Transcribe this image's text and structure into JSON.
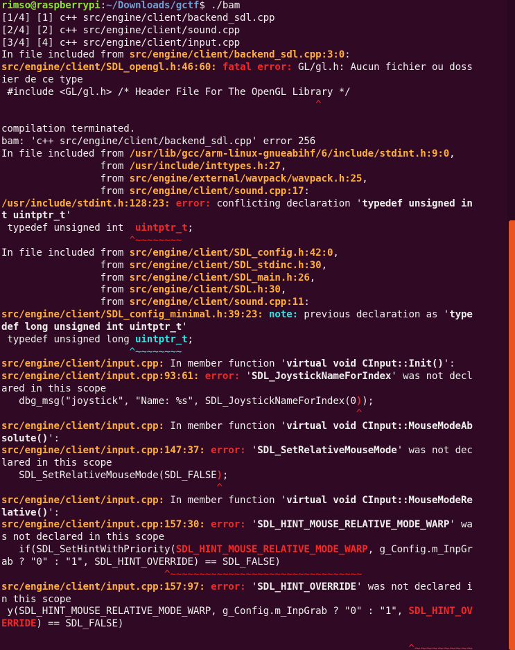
{
  "terminal": {
    "lines": [
      [
        [
          "prompt",
          "rimso@raspberrypi"
        ],
        [
          "plain",
          ":"
        ],
        [
          "path",
          "~/Downloads/gctf"
        ],
        [
          "plain",
          "$ ./bam"
        ]
      ],
      [
        [
          "plain",
          "[1/4] [1] c++ src/engine/client/backend_sdl.cpp"
        ]
      ],
      [
        [
          "plain",
          "[2/4] [2] c++ src/engine/client/sound.cpp"
        ]
      ],
      [
        [
          "plain",
          "[3/4] [4] c++ src/engine/client/input.cpp"
        ]
      ],
      [
        [
          "plain",
          "In file included from "
        ],
        [
          "file",
          "src/engine/client/backend_sdl.cpp:3:0"
        ],
        [
          "plain",
          ":"
        ]
      ],
      [
        [
          "file",
          "src/engine/client/SDL_opengl.h:46:60:"
        ],
        [
          "plain",
          " "
        ],
        [
          "err",
          "fatal error:"
        ],
        [
          "plain",
          " GL/gl.h: Aucun fichier ou doss"
        ]
      ],
      [
        [
          "plain",
          "ier de ce type"
        ]
      ],
      [
        [
          "plain",
          " #include <GL/gl.h> /* Header File For The OpenGL Library */"
        ]
      ],
      [
        [
          "plain",
          "                                                      "
        ],
        [
          "red",
          "^"
        ]
      ],
      [
        [
          "plain",
          ""
        ]
      ],
      [
        [
          "plain",
          "compilation terminated."
        ]
      ],
      [
        [
          "plain",
          "bam: 'c++ src/engine/client/backend_sdl.cpp' error 256"
        ]
      ],
      [
        [
          "plain",
          "In file included from "
        ],
        [
          "file",
          "/usr/lib/gcc/arm-linux-gnueabihf/6/include/stdint.h:9:0"
        ],
        [
          "plain",
          ","
        ]
      ],
      [
        [
          "plain",
          "                 from "
        ],
        [
          "file",
          "/usr/include/inttypes.h:27"
        ],
        [
          "plain",
          ","
        ]
      ],
      [
        [
          "plain",
          "                 from "
        ],
        [
          "file",
          "src/engine/external/wavpack/wavpack.h:25"
        ],
        [
          "plain",
          ","
        ]
      ],
      [
        [
          "plain",
          "                 from "
        ],
        [
          "file",
          "src/engine/client/sound.cpp:17"
        ],
        [
          "plain",
          ":"
        ]
      ],
      [
        [
          "file",
          "/usr/include/stdint.h:128:23:"
        ],
        [
          "plain",
          " "
        ],
        [
          "err",
          "error:"
        ],
        [
          "plain",
          " conflicting declaration '"
        ],
        [
          "bold",
          "typedef unsigned in"
        ]
      ],
      [
        [
          "bold",
          "t uintptr_t"
        ],
        [
          "plain",
          "'"
        ]
      ],
      [
        [
          "plain",
          " typedef unsigned int  "
        ],
        [
          "err",
          "uintptr_t"
        ],
        [
          "plain",
          ";"
        ]
      ],
      [
        [
          "plain",
          "                      "
        ],
        [
          "red",
          "^~~~~~~~~"
        ]
      ],
      [
        [
          "plain",
          "In file included from "
        ],
        [
          "file",
          "src/engine/client/SDL_config.h:42:0"
        ],
        [
          "plain",
          ","
        ]
      ],
      [
        [
          "plain",
          "                 from "
        ],
        [
          "file",
          "src/engine/client/SDL_stdinc.h:30"
        ],
        [
          "plain",
          ","
        ]
      ],
      [
        [
          "plain",
          "                 from "
        ],
        [
          "file",
          "src/engine/client/SDL_main.h:26"
        ],
        [
          "plain",
          ","
        ]
      ],
      [
        [
          "plain",
          "                 from "
        ],
        [
          "file",
          "src/engine/client/SDL.h:30"
        ],
        [
          "plain",
          ","
        ]
      ],
      [
        [
          "plain",
          "                 from "
        ],
        [
          "file",
          "src/engine/client/sound.cpp:11"
        ],
        [
          "plain",
          ":"
        ]
      ],
      [
        [
          "file",
          "src/engine/client/SDL_config_minimal.h:39:23:"
        ],
        [
          "plain",
          " "
        ],
        [
          "note",
          "note:"
        ],
        [
          "plain",
          " previous declaration as '"
        ],
        [
          "bold",
          "type"
        ]
      ],
      [
        [
          "bold",
          "def long unsigned int uintptr_t"
        ],
        [
          "plain",
          "'"
        ]
      ],
      [
        [
          "plain",
          " typedef unsigned long "
        ],
        [
          "note",
          "uintptr_t"
        ],
        [
          "plain",
          ";"
        ]
      ],
      [
        [
          "plain",
          "                      "
        ],
        [
          "cyan",
          "^~~~~~~~~"
        ]
      ],
      [
        [
          "file",
          "src/engine/client/input.cpp:"
        ],
        [
          "plain",
          " In member function '"
        ],
        [
          "bold",
          "virtual void CInput::Init()"
        ],
        [
          "plain",
          "':"
        ]
      ],
      [
        [
          "file",
          "src/engine/client/input.cpp:93:61:"
        ],
        [
          "plain",
          " "
        ],
        [
          "err",
          "error:"
        ],
        [
          "plain",
          " '"
        ],
        [
          "bold",
          "SDL_JoystickNameForIndex"
        ],
        [
          "plain",
          "' was not decl"
        ]
      ],
      [
        [
          "plain",
          "ared in this scope"
        ]
      ],
      [
        [
          "plain",
          "   dbg_msg(\"joystick\", \"Name: %s\", SDL_JoystickNameForIndex(0"
        ],
        [
          "err",
          ")"
        ],
        [
          "plain",
          ");"
        ]
      ],
      [
        [
          "plain",
          "                                                             "
        ],
        [
          "red",
          "^"
        ]
      ],
      [
        [
          "file",
          "src/engine/client/input.cpp:"
        ],
        [
          "plain",
          " In member function '"
        ],
        [
          "bold",
          "virtual void CInput::MouseModeAb"
        ]
      ],
      [
        [
          "bold",
          "solute()"
        ],
        [
          "plain",
          "':"
        ]
      ],
      [
        [
          "file",
          "src/engine/client/input.cpp:147:37:"
        ],
        [
          "plain",
          " "
        ],
        [
          "err",
          "error:"
        ],
        [
          "plain",
          " '"
        ],
        [
          "bold",
          "SDL_SetRelativeMouseMode"
        ],
        [
          "plain",
          "' was not dec"
        ]
      ],
      [
        [
          "plain",
          "lared in this scope"
        ]
      ],
      [
        [
          "plain",
          "   SDL_SetRelativeMouseMode(SDL_FALSE"
        ],
        [
          "err",
          ")"
        ],
        [
          "plain",
          ";"
        ]
      ],
      [
        [
          "plain",
          "                                     "
        ],
        [
          "red",
          "^"
        ]
      ],
      [
        [
          "file",
          "src/engine/client/input.cpp:"
        ],
        [
          "plain",
          " In member function '"
        ],
        [
          "bold",
          "virtual void CInput::MouseModeRe"
        ]
      ],
      [
        [
          "bold",
          "lative()"
        ],
        [
          "plain",
          "':"
        ]
      ],
      [
        [
          "file",
          "src/engine/client/input.cpp:157:30:"
        ],
        [
          "plain",
          " "
        ],
        [
          "err",
          "error:"
        ],
        [
          "plain",
          " '"
        ],
        [
          "bold",
          "SDL_HINT_MOUSE_RELATIVE_MODE_WARP"
        ],
        [
          "plain",
          "' wa"
        ]
      ],
      [
        [
          "plain",
          "s not declared in this scope"
        ]
      ],
      [
        [
          "plain",
          "   if(SDL_SetHintWithPriority("
        ],
        [
          "err",
          "SDL_HINT_MOUSE_RELATIVE_MODE_WARP"
        ],
        [
          "plain",
          ", g_Config.m_InpGr"
        ]
      ],
      [
        [
          "plain",
          "ab ? \"0\" : \"1\", SDL_HINT_OVERRIDE) == SDL_FALSE)"
        ]
      ],
      [
        [
          "plain",
          "                            "
        ],
        [
          "red",
          "^~~~~~~~~~~~~~~~~~~~~~~~~~~~~~~~~~"
        ]
      ],
      [
        [
          "file",
          "src/engine/client/input.cpp:157:97:"
        ],
        [
          "plain",
          " "
        ],
        [
          "err",
          "error:"
        ],
        [
          "plain",
          " '"
        ],
        [
          "bold",
          "SDL_HINT_OVERRIDE"
        ],
        [
          "plain",
          "' was not declared i"
        ]
      ],
      [
        [
          "plain",
          "n this scope"
        ]
      ],
      [
        [
          "plain",
          " y(SDL_HINT_MOUSE_RELATIVE_MODE_WARP, g_Config.m_InpGrab ? \"0\" : \"1\", "
        ],
        [
          "err",
          "SDL_HINT_OV"
        ]
      ],
      [
        [
          "err",
          "ERRIDE"
        ],
        [
          "plain",
          ") == SDL_FALSE)"
        ]
      ],
      [
        [
          "plain",
          ""
        ]
      ],
      [
        [
          "plain",
          "                                                                      "
        ],
        [
          "red",
          "^~~~~~~~~~~"
        ]
      ],
      [
        [
          "red",
          "~~~~~~"
        ]
      ]
    ]
  }
}
